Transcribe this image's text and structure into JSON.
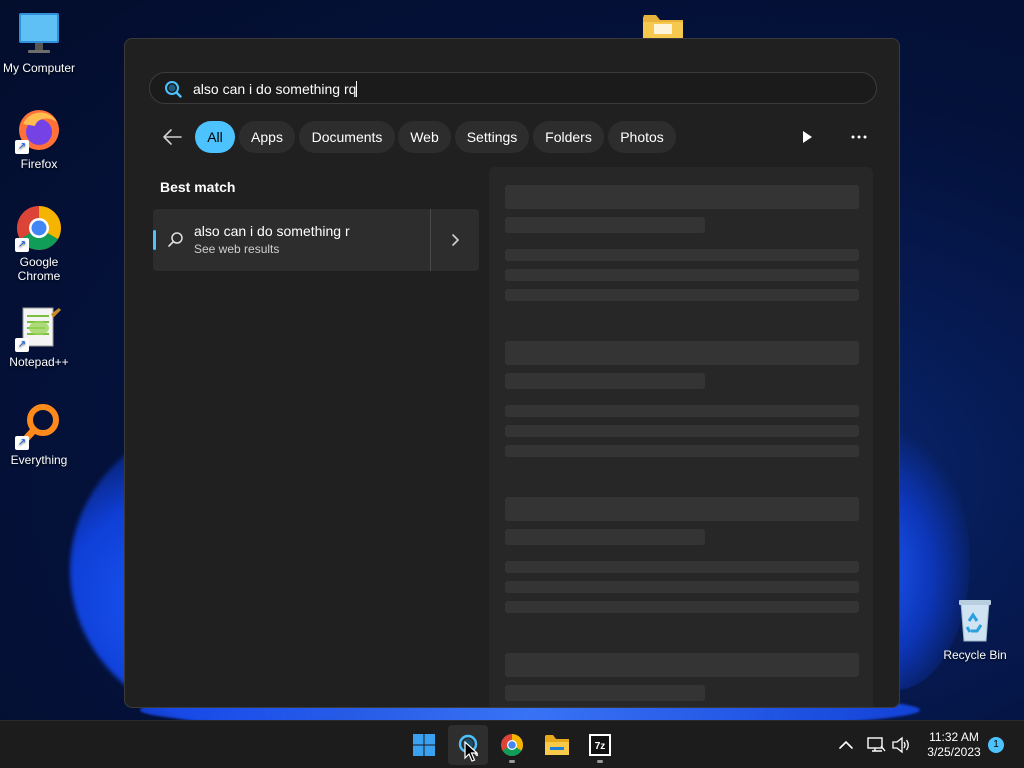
{
  "colors": {
    "accent": "#4cc2ff",
    "panel_bg": "#202020",
    "taskbar_bg": "#1c1c1c"
  },
  "desktop": {
    "icons": [
      {
        "label": "My Computer",
        "icon": "monitor-icon"
      },
      {
        "label": "Firefox",
        "icon": "firefox-icon"
      },
      {
        "label": "Google Chrome",
        "icon": "chrome-icon"
      },
      {
        "label": "Notepad++",
        "icon": "notepadpp-icon"
      },
      {
        "label": "Everything",
        "icon": "everything-search-icon"
      },
      {
        "label": "Recycle Bin",
        "icon": "recycle-bin-icon"
      }
    ]
  },
  "search": {
    "query": "also can i do something rq"
  },
  "filters": {
    "items": [
      {
        "label": "All",
        "active": true
      },
      {
        "label": "Apps",
        "active": false
      },
      {
        "label": "Documents",
        "active": false
      },
      {
        "label": "Web",
        "active": false
      },
      {
        "label": "Settings",
        "active": false
      },
      {
        "label": "Folders",
        "active": false
      },
      {
        "label": "Photos",
        "active": false
      }
    ]
  },
  "best_match": {
    "heading": "Best match",
    "title": "also can i do something r",
    "subtitle": "See web results"
  },
  "taskbar": {
    "apps": [
      "windows-start-icon",
      "search-icon",
      "chrome-icon",
      "file-explorer-icon",
      "7zip-icon"
    ],
    "time": "11:32 AM",
    "date": "3/25/2023",
    "notification_count": "1"
  }
}
